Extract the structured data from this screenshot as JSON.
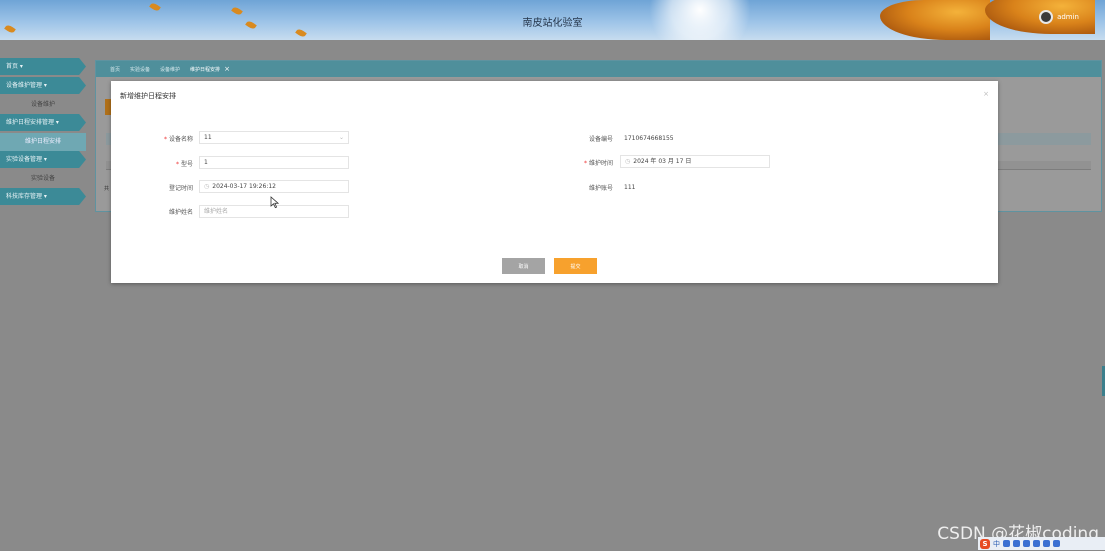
{
  "header": {
    "title": "南皮站化验室",
    "user_name": "admin"
  },
  "sidebar": {
    "items": [
      {
        "label": "首页",
        "type": "menu"
      },
      {
        "label": "设备维护管理",
        "type": "menu"
      },
      {
        "label": "设备维护",
        "type": "sub"
      },
      {
        "label": "维护日程安排管理",
        "type": "menu"
      },
      {
        "label": "维护日程安排",
        "type": "sub",
        "active": true
      },
      {
        "label": "实验设备管理",
        "type": "menu"
      },
      {
        "label": "实验设备",
        "type": "sub"
      },
      {
        "label": "科技库存管理",
        "type": "menu"
      }
    ]
  },
  "tabs": [
    {
      "label": "首页"
    },
    {
      "label": "实验设备"
    },
    {
      "label": "设备维护"
    },
    {
      "label": "维护日程安排",
      "active": true
    }
  ],
  "pagination_label": "共",
  "modal": {
    "title": "新增维护日程安排",
    "close": "×",
    "fields": {
      "device_name": {
        "label": "设备名称",
        "value": "11"
      },
      "device_code": {
        "label": "设备编号",
        "value": "1710674668155"
      },
      "model": {
        "label": "型号",
        "value": "1"
      },
      "maintain_time": {
        "label": "维护时间",
        "value": "2024 年 03 月 17 日"
      },
      "register_time": {
        "label": "登记时间",
        "value": "2024-03-17 19:26:12"
      },
      "maintainer_account": {
        "label": "维护账号",
        "value": "111"
      },
      "maintainer_name": {
        "label": "维护姓名",
        "placeholder": "维护姓名"
      }
    },
    "buttons": {
      "cancel": "取消",
      "submit": "提交"
    }
  },
  "watermark": "CSDN @花椒coding",
  "ime": {
    "label": "中"
  }
}
